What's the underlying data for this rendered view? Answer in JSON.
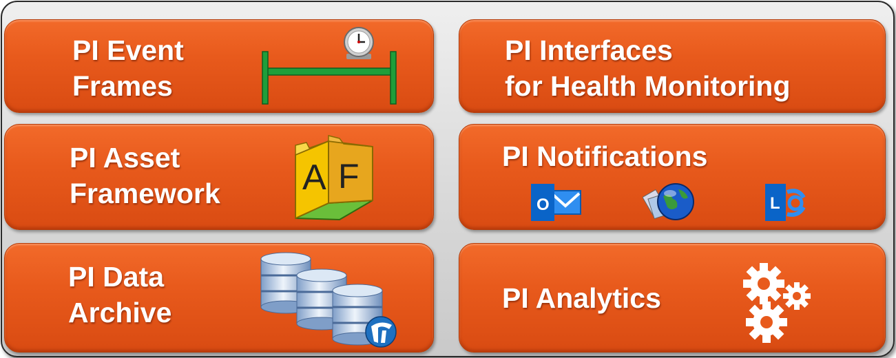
{
  "tiles": {
    "event_frames": {
      "line1": "PI Event",
      "line2": "Frames"
    },
    "interfaces": {
      "line1": "PI Interfaces",
      "line2": "for Health Monitoring"
    },
    "asset_framework": {
      "line1": "PI Asset",
      "line2": "Framework"
    },
    "notifications": {
      "line1": "PI Notifications"
    },
    "data_archive": {
      "line1": "PI Data",
      "line2": "Archive"
    },
    "analytics": {
      "line1": "PI Analytics"
    }
  },
  "icons": {
    "af_letter_a": "A",
    "af_letter_f": "F",
    "outlook_letter": "O",
    "lync_letter": "L"
  },
  "colors": {
    "tile": "#e85a1c",
    "timeline_green": "#1f9e3a",
    "af_yellow": "#f5c400",
    "outlook_blue": "#0a64c8"
  }
}
